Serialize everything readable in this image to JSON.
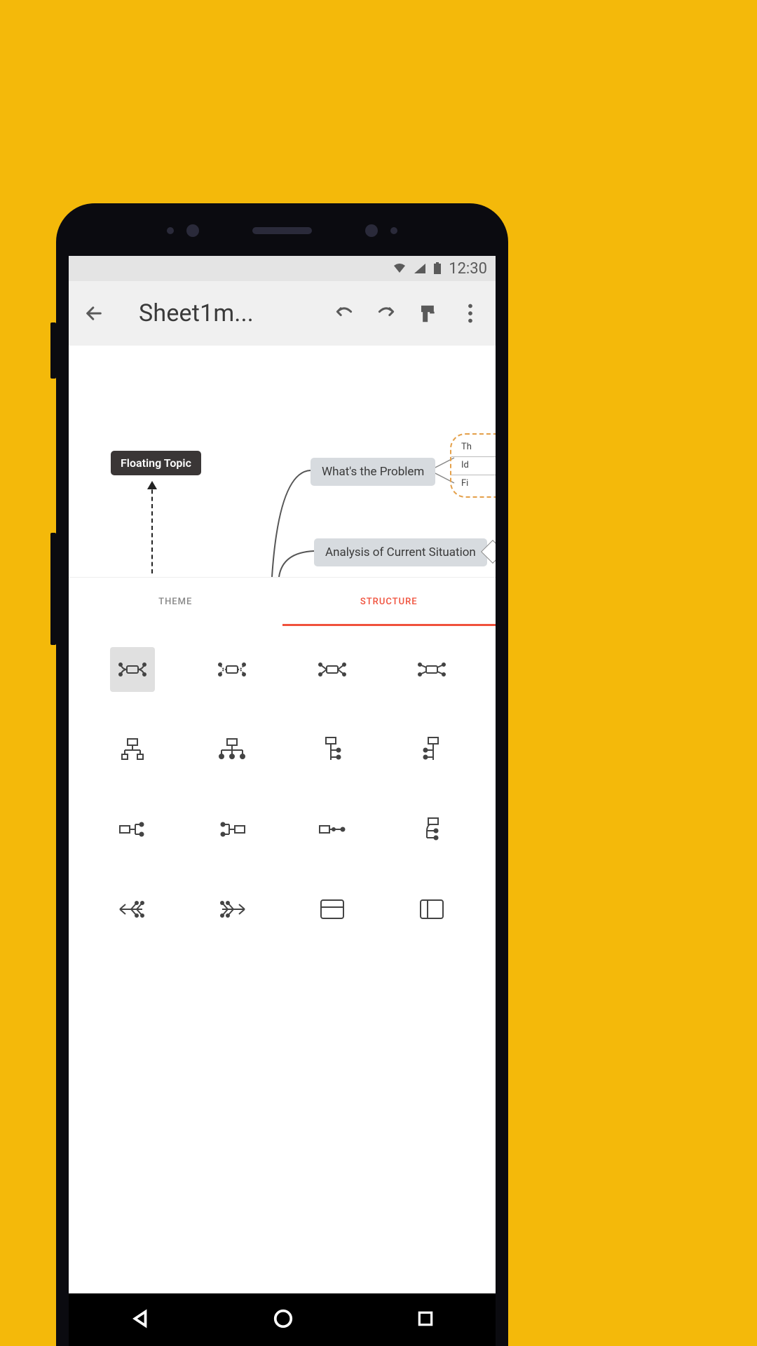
{
  "statusbar": {
    "time": "12:30"
  },
  "toolbar": {
    "title": "Sheet1m..."
  },
  "canvas": {
    "floating_topic": "Floating Topic",
    "node1": "What's the Problem",
    "node2": "Analysis of Current Situation",
    "side_items": [
      "Th",
      "Id",
      "Fi"
    ]
  },
  "tabs": {
    "theme": "THEME",
    "structure": "STRUCTURE"
  }
}
